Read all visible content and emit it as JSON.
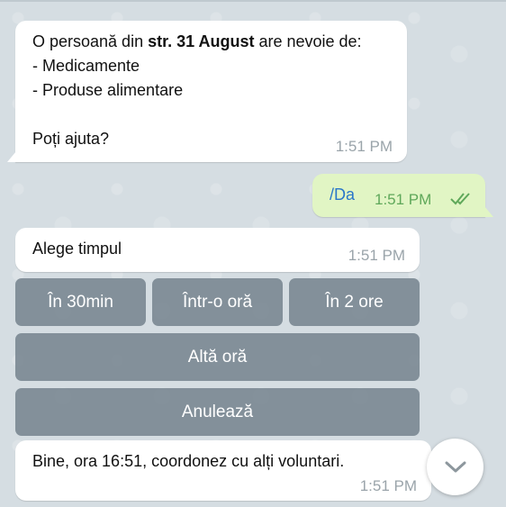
{
  "chat": {
    "messages": [
      {
        "lines_before": "O persoană din ",
        "bold": "str. 31 August",
        "lines_after": " are nevoie de:\n- Medicamente\n- Produse alimentare\n\nPoți ajuta?",
        "time": "1:51 PM"
      },
      {
        "command": "/Da",
        "time": "1:51 PM"
      },
      {
        "text": "Alege timpul",
        "time": "1:51 PM"
      },
      {
        "text": "Bine, ora 16:51, coordonez cu alți voluntari.",
        "time": "1:51 PM"
      }
    ],
    "keyboard": {
      "row1": [
        "În 30min",
        "Într-o oră",
        "În 2 ore"
      ],
      "row2": "Altă oră",
      "row3": "Anulează"
    }
  },
  "icons": {
    "read_receipt": "double-check-icon",
    "scroll": "chevron-down-icon"
  },
  "colors": {
    "background": "#d5dde2",
    "incoming": "#ffffff",
    "outgoing": "#e1f5c4",
    "link": "#2a77c9",
    "button": "#74828d"
  }
}
